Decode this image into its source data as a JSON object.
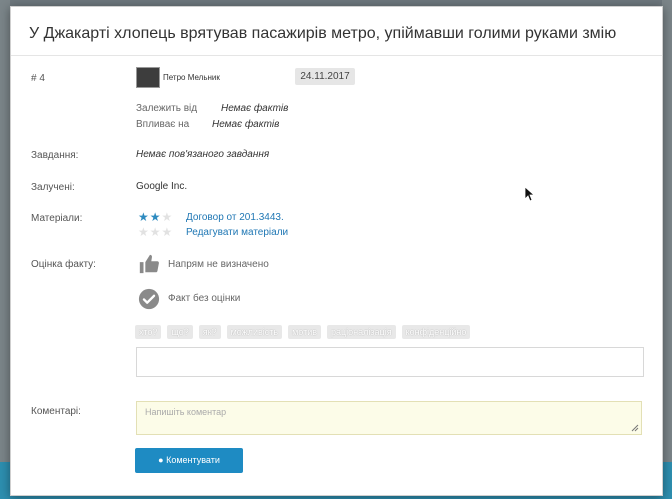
{
  "modal": {
    "title": "У Джакарті хлопець врятував пасажирів метро, упіймавши голими руками змію"
  },
  "meta": {
    "id_label": "# 4",
    "author_name": "Петро Мельник",
    "date": "24.11.2017"
  },
  "relations": {
    "depends_label": "Залежить від",
    "depends_value": "Немає фактів",
    "affects_label": "Впливає на",
    "affects_value": "Немає фактів"
  },
  "task": {
    "label": "Завдання:",
    "value": "Немає пов'язаного завдання"
  },
  "involved": {
    "label": "Залучені:",
    "value": "Google Inc."
  },
  "materials": {
    "label": "Матеріали:",
    "items": [
      {
        "rating": 2,
        "max": 3,
        "title": "Договор от 201.3443."
      }
    ],
    "edit_link": "Редагувати матеріали"
  },
  "evaluation": {
    "label": "Оцінка факту:",
    "direction": "Напрям не визначено",
    "rating": "Факт без оцінки"
  },
  "tags": [
    "хто?",
    "що?",
    "як?",
    "можливість",
    "мотив",
    "раціоналізація",
    "конфіденційно"
  ],
  "tag_input": {
    "value": ""
  },
  "comments": {
    "label": "Коментарі:",
    "placeholder": "Напишіть коментар",
    "submit_label": "Коментувати"
  },
  "colors": {
    "accent": "#1e8bc3",
    "link": "#1f77b4",
    "star_on": "#2e8bc0",
    "star_off": "#e2e2e2",
    "comment_bg": "#fcfce8"
  }
}
